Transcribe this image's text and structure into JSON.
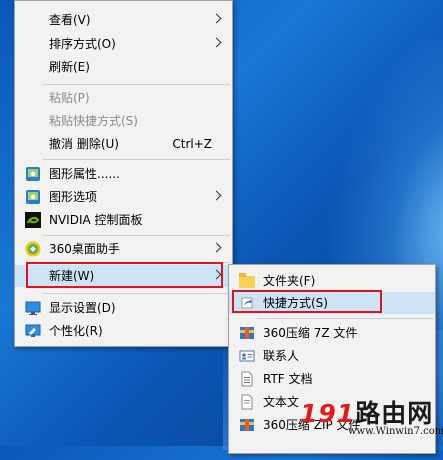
{
  "desktop": {
    "wallpaper": "windows-10-blue"
  },
  "context_menu": {
    "items": [
      {
        "label": "查看(V)",
        "has_submenu": true
      },
      {
        "label": "排序方式(O)",
        "has_submenu": true
      },
      {
        "label": "刷新(E)"
      },
      {
        "label": "粘贴(P)",
        "disabled": true
      },
      {
        "label": "粘贴快捷方式(S)",
        "disabled": true
      },
      {
        "label": "撤消 删除(U)",
        "shortcut": "Ctrl+Z"
      },
      {
        "label": "图形属性......",
        "icon": "graphics-properties-icon"
      },
      {
        "label": "图形选项",
        "icon": "graphics-options-icon",
        "has_submenu": true
      },
      {
        "label": "NVIDIA 控制面板",
        "icon": "nvidia-icon"
      },
      {
        "label": "360桌面助手",
        "icon": "360-icon",
        "has_submenu": true
      },
      {
        "label": "新建(W)",
        "has_submenu": true,
        "highlighted": true
      },
      {
        "label": "显示设置(D)",
        "icon": "display-icon"
      },
      {
        "label": "个性化(R)",
        "icon": "personalize-icon"
      }
    ]
  },
  "new_submenu": {
    "items": [
      {
        "label": "文件夹(F)",
        "icon": "folder-icon"
      },
      {
        "label": "快捷方式(S)",
        "icon": "shortcut-icon",
        "highlighted": true
      },
      {
        "label": "360压缩 7Z 文件",
        "icon": "archive-icon"
      },
      {
        "label": "联系人",
        "icon": "contact-icon"
      },
      {
        "label": "RTF 文档",
        "icon": "rtf-icon"
      },
      {
        "label": "文本文",
        "icon": "text-doc-icon"
      },
      {
        "label": "360压缩 ZIP 文件",
        "icon": "zip-icon"
      }
    ]
  },
  "watermark": {
    "text_num": "191",
    "text_cn": "路由网",
    "url": "www.Winwin7.com"
  },
  "colors": {
    "highlight": "#cde4f7",
    "annotation_red": "#e0141e",
    "menu_bg": "#f2f2f2"
  }
}
